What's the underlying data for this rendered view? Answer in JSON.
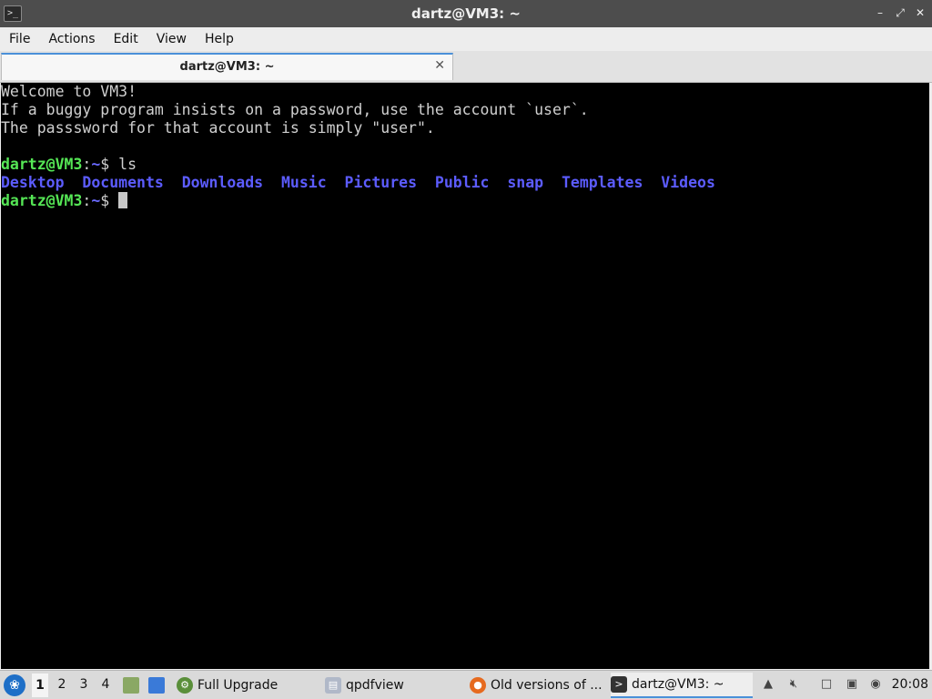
{
  "window": {
    "title": "dartz@VM3: ~",
    "controls": {
      "minimize": "–",
      "maximize": "⤢",
      "close": "✕"
    }
  },
  "menu": [
    "File",
    "Actions",
    "Edit",
    "View",
    "Help"
  ],
  "tab": {
    "label": "dartz@VM3: ~",
    "close": "✕"
  },
  "terminal": {
    "motd": [
      "Welcome to VM3!",
      "If a buggy program insists on a password, use the account `user`.",
      "The passsword for that account is simply \"user\"."
    ],
    "prompt": {
      "user": "dartz@VM3",
      "sep": ":",
      "path": "~",
      "symbol": "$ "
    },
    "command": "ls",
    "dirs": [
      "Desktop",
      "Documents",
      "Downloads",
      "Music",
      "Pictures",
      "Public",
      "snap",
      "Templates",
      "Videos"
    ]
  },
  "taskbar": {
    "workspaces": [
      "1",
      "2",
      "3",
      "4"
    ],
    "tasks": [
      {
        "label": "Full Upgrade",
        "icon": "gear-icon"
      },
      {
        "label": "qpdfview",
        "icon": "pdf-icon"
      },
      {
        "label": "Old versions of ...",
        "icon": "firefox-icon"
      },
      {
        "label": "dartz@VM3: ~",
        "icon": "terminal-icon"
      }
    ],
    "clock": "20:08"
  },
  "colors": {
    "prompt_user": "#55e655",
    "directory": "#5c5cff",
    "titlebar": "#4d4d4d",
    "accent": "#4a90d9"
  }
}
